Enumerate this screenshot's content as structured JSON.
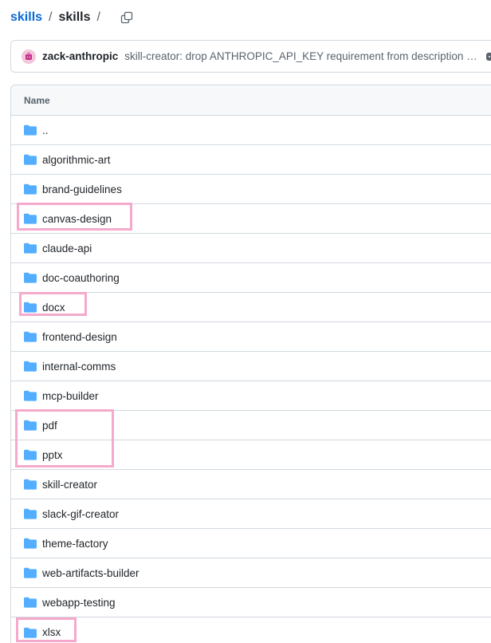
{
  "breadcrumb": {
    "repo_link": "skills",
    "separator": "/",
    "current": "skills",
    "trailing_separator": "/",
    "copy_icon": "copy-icon"
  },
  "commit": {
    "avatar_icon": "avatar",
    "author": "zack-anthropic",
    "message": "skill-creator: drop ANTHROPIC_API_KEY requirement from description optimizer",
    "more_icon": "ellipsis-icon"
  },
  "table": {
    "header_name": "Name",
    "parent_label": "..",
    "folder_color": "#54aeff",
    "rows": [
      {
        "name": "algorithmic-art"
      },
      {
        "name": "brand-guidelines"
      },
      {
        "name": "canvas-design"
      },
      {
        "name": "claude-api"
      },
      {
        "name": "doc-coauthoring"
      },
      {
        "name": "docx"
      },
      {
        "name": "frontend-design"
      },
      {
        "name": "internal-comms"
      },
      {
        "name": "mcp-builder"
      },
      {
        "name": "pdf"
      },
      {
        "name": "pptx"
      },
      {
        "name": "skill-creator"
      },
      {
        "name": "slack-gif-creator"
      },
      {
        "name": "theme-factory"
      },
      {
        "name": "web-artifacts-builder"
      },
      {
        "name": "webapp-testing"
      },
      {
        "name": "xlsx"
      }
    ]
  },
  "highlight_color": "#f5a9cc"
}
